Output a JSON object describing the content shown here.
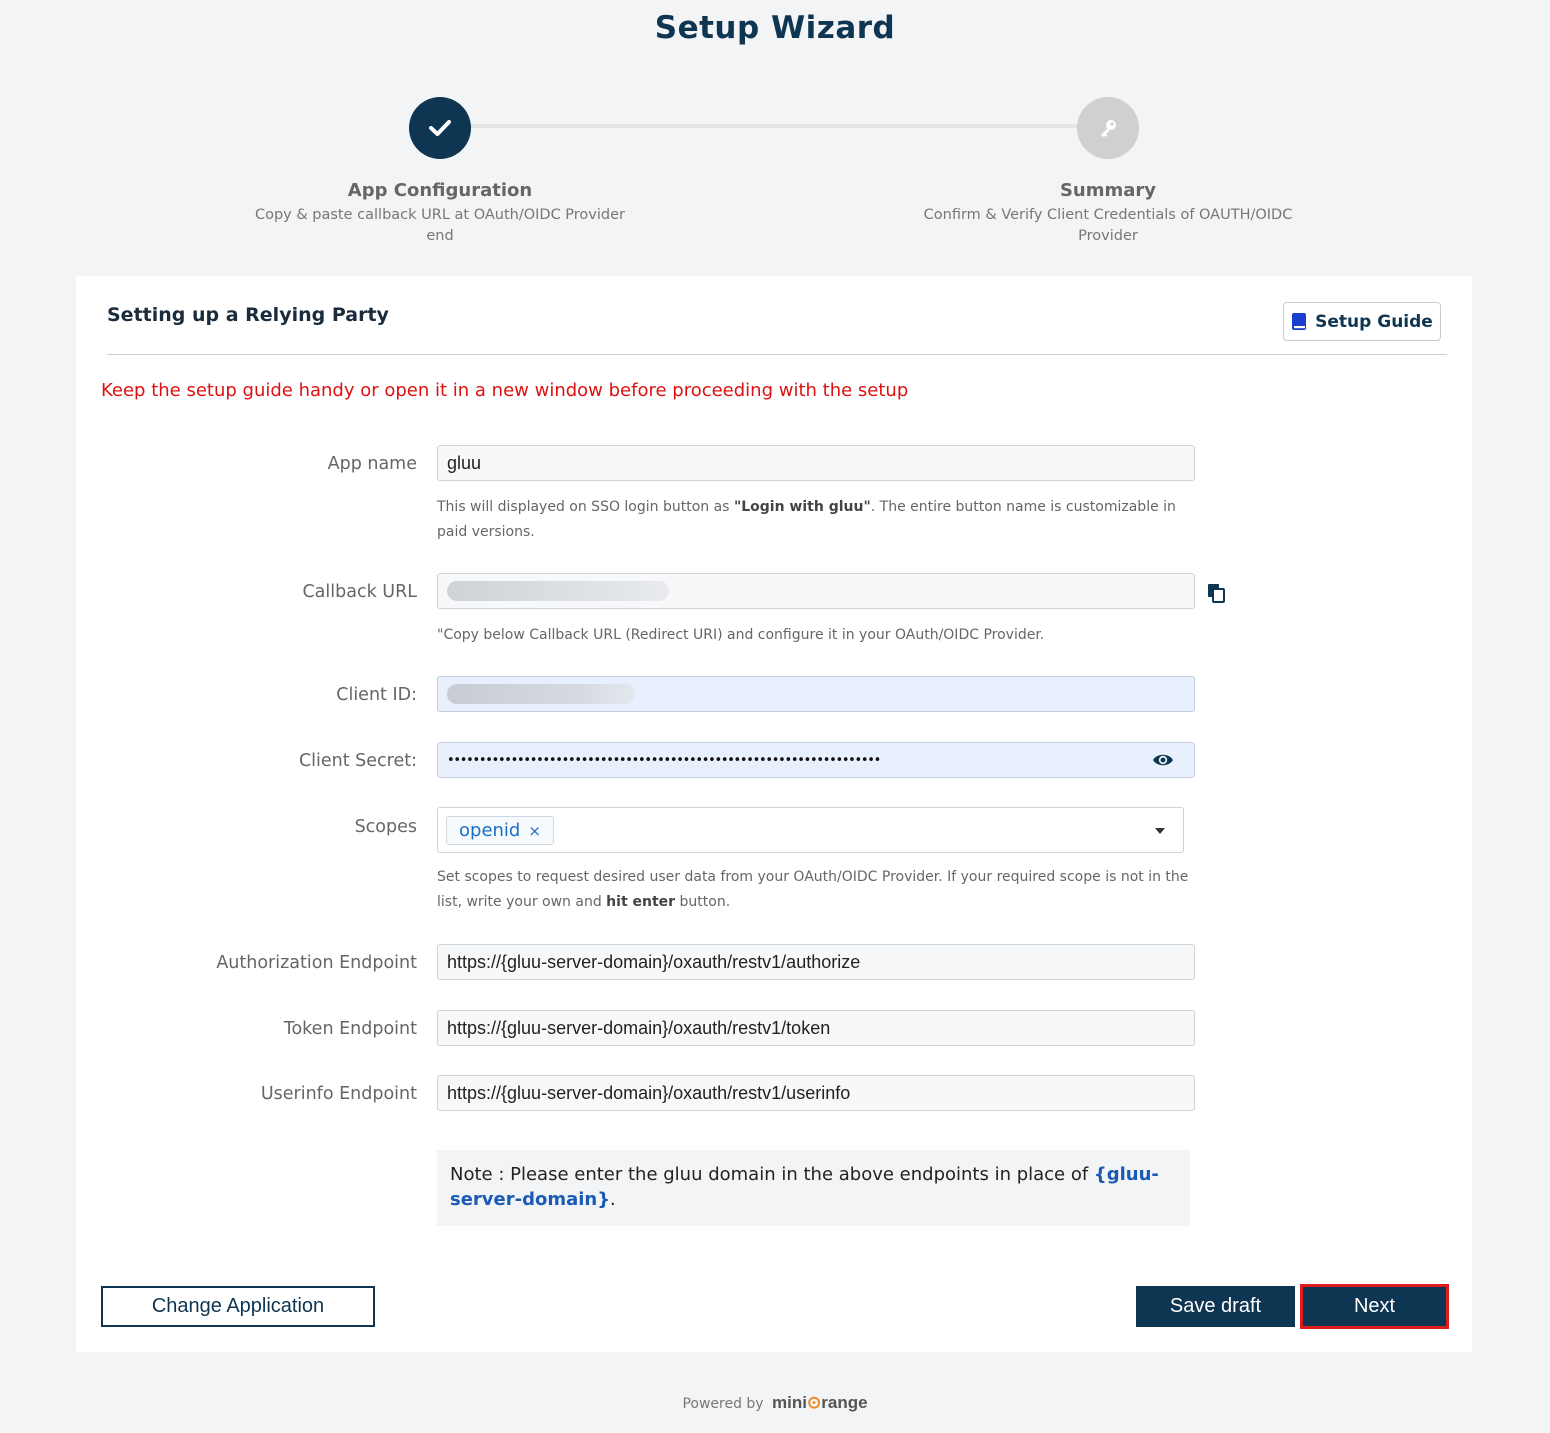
{
  "header": {
    "title": "Setup Wizard"
  },
  "steps": [
    {
      "title": "App Configuration",
      "desc_line1": "Copy & paste callback URL at OAuth/OIDC Provider",
      "desc_line2": "end",
      "status": "completed",
      "icon": "check-icon"
    },
    {
      "title": "Summary",
      "desc_line1": "Confirm & Verify Client Credentials of OAUTH/OIDC",
      "desc_line2": "Provider",
      "status": "pending",
      "icon": "key-icon"
    }
  ],
  "card": {
    "title": "Setting up a Relying Party",
    "guide_button": "Setup Guide",
    "warning": "Keep the setup guide handy or open it in a new window before proceeding with the setup"
  },
  "form": {
    "app_name": {
      "label": "App name",
      "value": "gluu",
      "help_pre": "This will displayed on SSO login button as ",
      "help_bold": "\"Login with gluu\"",
      "help_post": ". The entire button name is customizable in paid versions."
    },
    "callback_url": {
      "label": "Callback URL",
      "help": "\"Copy below Callback URL (Redirect URI) and configure it in your OAuth/OIDC Provider."
    },
    "client_id": {
      "label": "Client ID:"
    },
    "client_secret": {
      "label": "Client Secret:",
      "value": "••••••••••••••••••••••••••••••••••••••••••••••••••••••••••••••••••••"
    },
    "scopes": {
      "label": "Scopes",
      "selected": "openid",
      "remove_glyph": "×",
      "help_pre": "Set scopes to request desired user data from your OAuth/OIDC Provider. If your required scope is not in the list, write your own and ",
      "help_bold": "hit enter",
      "help_post": " button."
    },
    "authorization_endpoint": {
      "label": "Authorization Endpoint",
      "value": "https://{gluu-server-domain}/oxauth/restv1/authorize"
    },
    "token_endpoint": {
      "label": "Token Endpoint",
      "value": "https://{gluu-server-domain}/oxauth/restv1/token"
    },
    "userinfo_endpoint": {
      "label": "Userinfo Endpoint",
      "value": "https://{gluu-server-domain}/oxauth/restv1/userinfo"
    },
    "note": {
      "pre": "Note : Please enter the gluu domain in the above endpoints in place of ",
      "bold": "{gluu-server-domain}",
      "post": "."
    }
  },
  "actions": {
    "change_application": "Change Application",
    "save_draft": "Save draft",
    "next": "Next"
  },
  "footer": {
    "powered_by": "Powered by",
    "brand_pre": "mini",
    "brand_post": "range"
  },
  "colors": {
    "primary": "#0e3551",
    "warning": "#dd1111",
    "link": "#1a6fc9",
    "highlight_border": "#e01b1b"
  }
}
